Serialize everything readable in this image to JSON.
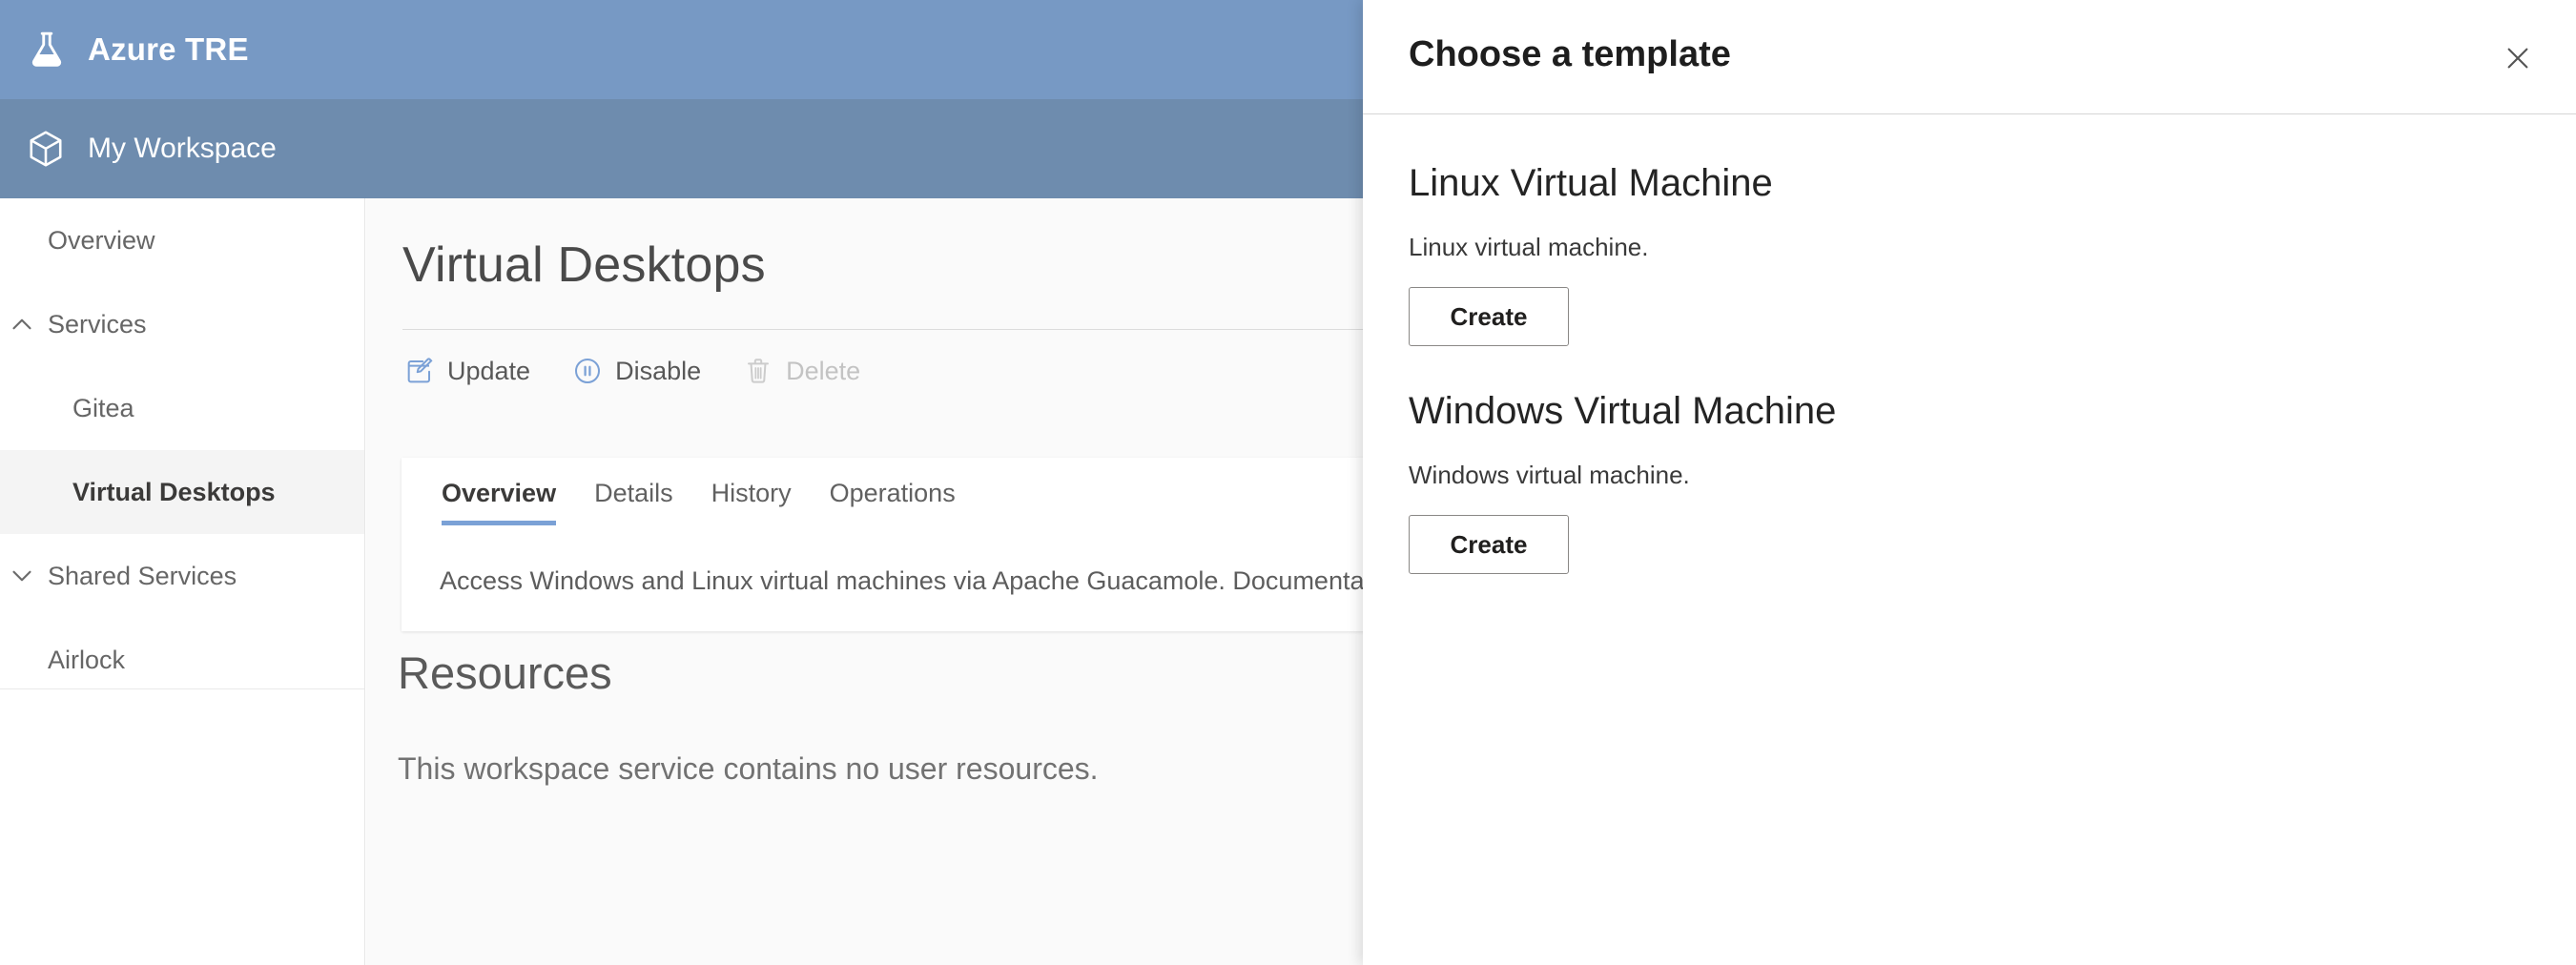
{
  "brand": {
    "title": "Azure TRE",
    "logo_icon": "flask-icon"
  },
  "workspace": {
    "title": "My Workspace",
    "icon": "cube-icon"
  },
  "sidebar": {
    "items": [
      {
        "label": "Overview",
        "level": 1,
        "chevron": "",
        "active": false
      },
      {
        "label": "Services",
        "level": 1,
        "chevron": "chevron-up-icon",
        "active": false
      },
      {
        "label": "Gitea",
        "level": 2,
        "chevron": "",
        "active": false
      },
      {
        "label": "Virtual Desktops",
        "level": 2,
        "chevron": "",
        "active": true
      },
      {
        "label": "Shared Services",
        "level": 1,
        "chevron": "chevron-down-icon",
        "active": false
      },
      {
        "label": "Airlock",
        "level": 1,
        "chevron": "",
        "active": false
      }
    ]
  },
  "main": {
    "page_title": "Virtual Desktops",
    "commands": [
      {
        "label": "Update",
        "icon": "edit-icon",
        "disabled": false
      },
      {
        "label": "Disable",
        "icon": "pause-circle-icon",
        "disabled": false
      },
      {
        "label": "Delete",
        "icon": "trash-icon",
        "disabled": true
      }
    ],
    "tabs": [
      {
        "label": "Overview",
        "active": true
      },
      {
        "label": "Details",
        "active": false
      },
      {
        "label": "History",
        "active": false
      },
      {
        "label": "Operations",
        "active": false
      }
    ],
    "description_text": "Access Windows and Linux virtual machines via Apache Guacamole. Documentation: ",
    "description_link": "guacamole.html",
    "resources_title": "Resources",
    "resources_empty": "This workspace service contains no user resources."
  },
  "panel": {
    "title": "Choose a template",
    "close_icon": "close-icon",
    "templates": [
      {
        "name": "Linux Virtual Machine",
        "description": "Linux virtual machine.",
        "create_label": "Create"
      },
      {
        "name": "Windows Virtual Machine",
        "description": "Windows virtual machine.",
        "create_label": "Create"
      }
    ]
  },
  "colors": {
    "brand_bar": "#7799c4",
    "workspace_bar": "#6e8cae",
    "accent": "#7ba1d6",
    "link": "#5b5bd6",
    "icon_blue": "#7ba1d6"
  }
}
